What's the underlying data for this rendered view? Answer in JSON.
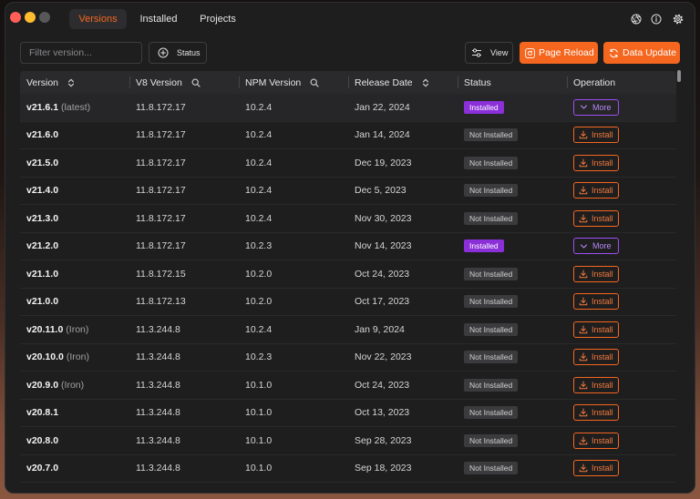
{
  "window": {
    "traffic_lights": [
      "#ff5f57",
      "#febc2e",
      "#58585a"
    ]
  },
  "tabs": [
    {
      "label": "Versions",
      "active": true
    },
    {
      "label": "Installed",
      "active": false
    },
    {
      "label": "Projects",
      "active": false
    }
  ],
  "header_icons": [
    "aperture-icon",
    "info-icon",
    "gear-icon"
  ],
  "toolbar": {
    "filter_placeholder": "Filter version...",
    "status_icon": "circle-plus-icon",
    "status_label": "Status",
    "view_icon": "sliders-icon",
    "view_label": "View",
    "page_reload_icon": "reload-icon",
    "page_reload_label": "Page Reload",
    "data_update_icon": "sync-icon",
    "data_update_label": "Data Update"
  },
  "table": {
    "columns": [
      {
        "label": "Version",
        "icon": "sort-icon"
      },
      {
        "label": "V8 Version",
        "icon": "search-icon"
      },
      {
        "label": "NPM Version",
        "icon": "search-icon"
      },
      {
        "label": "Release Date",
        "icon": "sort-icon"
      },
      {
        "label": "Status"
      },
      {
        "label": "Operation"
      }
    ],
    "rows": [
      {
        "version": "v21.6.1",
        "tag": "(latest)",
        "v8": "11.8.172.17",
        "npm": "10.2.4",
        "date": "Jan 22, 2024",
        "status": "Installed",
        "action": "More"
      },
      {
        "version": "v21.6.0",
        "v8": "11.8.172.17",
        "npm": "10.2.4",
        "date": "Jan 14, 2024",
        "status": "Not Installed",
        "action": "Install"
      },
      {
        "version": "v21.5.0",
        "v8": "11.8.172.17",
        "npm": "10.2.4",
        "date": "Dec 19, 2023",
        "status": "Not Installed",
        "action": "Install"
      },
      {
        "version": "v21.4.0",
        "v8": "11.8.172.17",
        "npm": "10.2.4",
        "date": "Dec 5, 2023",
        "status": "Not Installed",
        "action": "Install"
      },
      {
        "version": "v21.3.0",
        "v8": "11.8.172.17",
        "npm": "10.2.4",
        "date": "Nov 30, 2023",
        "status": "Not Installed",
        "action": "Install"
      },
      {
        "version": "v21.2.0",
        "v8": "11.8.172.17",
        "npm": "10.2.3",
        "date": "Nov 14, 2023",
        "status": "Installed",
        "action": "More"
      },
      {
        "version": "v21.1.0",
        "v8": "11.8.172.15",
        "npm": "10.2.0",
        "date": "Oct 24, 2023",
        "status": "Not Installed",
        "action": "Install"
      },
      {
        "version": "v21.0.0",
        "v8": "11.8.172.13",
        "npm": "10.2.0",
        "date": "Oct 17, 2023",
        "status": "Not Installed",
        "action": "Install"
      },
      {
        "version": "v20.11.0",
        "tag": "(Iron)",
        "v8": "11.3.244.8",
        "npm": "10.2.4",
        "date": "Jan 9, 2024",
        "status": "Not Installed",
        "action": "Install"
      },
      {
        "version": "v20.10.0",
        "tag": "(Iron)",
        "v8": "11.3.244.8",
        "npm": "10.2.3",
        "date": "Nov 22, 2023",
        "status": "Not Installed",
        "action": "Install"
      },
      {
        "version": "v20.9.0",
        "tag": "(Iron)",
        "v8": "11.3.244.8",
        "npm": "10.1.0",
        "date": "Oct 24, 2023",
        "status": "Not Installed",
        "action": "Install"
      },
      {
        "version": "v20.8.1",
        "v8": "11.3.244.8",
        "npm": "10.1.0",
        "date": "Oct 13, 2023",
        "status": "Not Installed",
        "action": "Install"
      },
      {
        "version": "v20.8.0",
        "v8": "11.3.244.8",
        "npm": "10.1.0",
        "date": "Sep 28, 2023",
        "status": "Not Installed",
        "action": "Install"
      },
      {
        "version": "v20.7.0",
        "v8": "11.3.244.8",
        "npm": "10.1.0",
        "date": "Sep 18, 2023",
        "status": "Not Installed",
        "action": "Install"
      }
    ]
  },
  "colors": {
    "accent": "#f5661f",
    "installed": "#8b2fd9",
    "more_outline": "#9d4ff2",
    "background": "#1e1e1f"
  }
}
